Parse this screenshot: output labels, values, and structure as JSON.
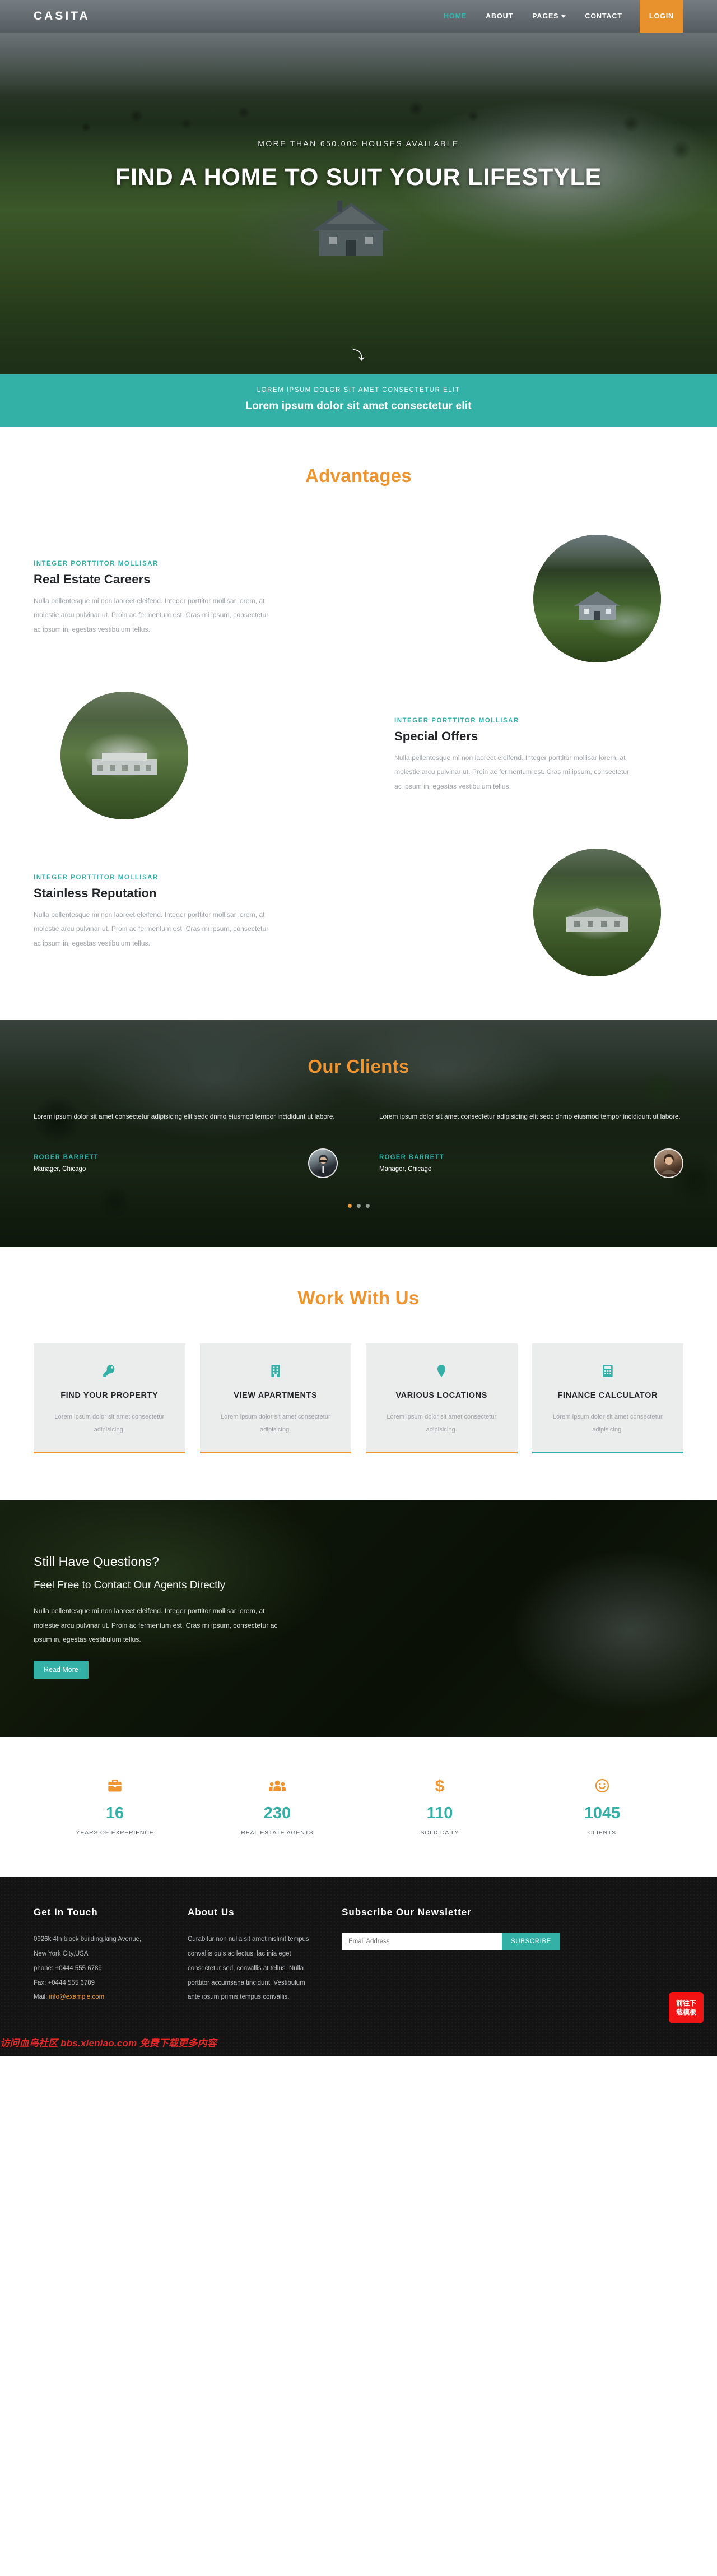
{
  "nav": {
    "brand": "CASITA",
    "items": [
      {
        "label": "HOME",
        "active": true,
        "caret": false
      },
      {
        "label": "ABOUT",
        "active": false,
        "caret": false
      },
      {
        "label": "PAGES",
        "active": false,
        "caret": true
      },
      {
        "label": "CONTACT",
        "active": false,
        "caret": false
      }
    ],
    "login_label": "LOGIN",
    "accent_teal": "#2eb8ae",
    "accent_orange": "#e8922e"
  },
  "hero": {
    "subtitle": "MORE THAN 650.000 HOUSES AVAILABLE",
    "title": "FIND A HOME TO SUIT YOUR LIFESTYLE",
    "scroll_icon": "chevron-down-icon"
  },
  "tealbar": {
    "small": "LOREM IPSUM DOLOR SIT AMET CONSECTETUR ELIT",
    "big": "Lorem ipsum dolor sit amet consectetur elit",
    "bg": "#33b1a7"
  },
  "advantages": {
    "title": "Advantages",
    "title_color": "#ee9531",
    "items": [
      {
        "kicker": "INTEGER PORTTITOR MOLLISAR",
        "heading": "Real Estate Careers",
        "body": "Nulla pellentesque mi non laoreet eleifend. Integer porttitor mollisar lorem, at molestie arcu pulvinar ut. Proin ac fermentum est. Cras mi ipsum, consectetur ac ipsum in, egestas vestibulum tellus.",
        "image_alt": "aerial-house-photo"
      },
      {
        "kicker": "INTEGER PORTTITOR MOLLISAR",
        "heading": "Special Offers",
        "body": "Nulla pellentesque mi non laoreet eleifend. Integer porttitor mollisar lorem, at molestie arcu pulvinar ut. Proin ac fermentum est. Cras mi ipsum, consectetur ac ipsum in, egestas vestibulum tellus.",
        "image_alt": "aerial-estate-photo"
      },
      {
        "kicker": "INTEGER PORTTITOR MOLLISAR",
        "heading": "Stainless Reputation",
        "body": "Nulla pellentesque mi non laoreet eleifend. Integer porttitor mollisar lorem, at molestie arcu pulvinar ut. Proin ac fermentum est. Cras mi ipsum, consectetur ac ipsum in, egestas vestibulum tellus.",
        "image_alt": "aerial-mansion-photo"
      }
    ]
  },
  "clients": {
    "title": "Our Clients",
    "testimonials": [
      {
        "quote": "Lorem ipsum dolor sit amet consectetur adipisicing elit sedc dnmo eiusmod tempor incididunt ut labore.",
        "name": "ROGER BARRETT",
        "role": "Manager, Chicago",
        "avatar": "avatar-man-glasses"
      },
      {
        "quote": "Lorem ipsum dolor sit amet consectetur adipisicing elit sedc dnmo eiusmod tempor incididunt ut labore.",
        "name": "ROGER BARRETT",
        "role": "Manager, Chicago",
        "avatar": "avatar-man-smiling"
      }
    ],
    "dots": [
      true,
      false,
      false
    ]
  },
  "work": {
    "title": "Work With Us",
    "cards": [
      {
        "icon": "key-icon",
        "heading": "FIND YOUR PROPERTY",
        "body": "Lorem ipsum dolor sit amet consectetur adipisicing.",
        "accent": "#ee9531"
      },
      {
        "icon": "building-icon",
        "heading": "VIEW APARTMENTS",
        "body": "Lorem ipsum dolor sit amet consectetur adipisicing.",
        "accent": "#ee9531"
      },
      {
        "icon": "map-pin-icon",
        "heading": "VARIOUS LOCATIONS",
        "body": "Lorem ipsum dolor sit amet consectetur adipisicing.",
        "accent": "#ee9531"
      },
      {
        "icon": "calculator-icon",
        "heading": "FINANCE CALCULATOR",
        "body": "Lorem ipsum dolor sit amet consectetur adipisicing.",
        "accent": "#33b1a7"
      }
    ]
  },
  "questions": {
    "heading": "Still Have Questions?",
    "subheading": "Feel Free to Contact Our Agents Directly",
    "body": "Nulla pellentesque mi non laoreet eleifend. Integer porttitor mollisar lorem, at molestie arcu pulvinar ut. Proin ac fermentum est. Cras mi ipsum, consectetur ac ipsum in, egestas vestibulum tellus.",
    "button_label": "Read More"
  },
  "counters": [
    {
      "icon": "briefcase-icon",
      "value": "16",
      "label": "YEARS OF EXPERIENCE"
    },
    {
      "icon": "people-group-icon",
      "value": "230",
      "label": "REAL ESTATE AGENTS"
    },
    {
      "icon": "dollar-sign-icon",
      "value": "110",
      "label": "SOLD DAILY"
    },
    {
      "icon": "smiley-face-icon",
      "value": "1045",
      "label": "CLIENTS"
    }
  ],
  "footer": {
    "contact": {
      "heading": "Get In Touch",
      "address_1": "0926k 4th block building,king Avenue,",
      "address_2": "New York City,USA",
      "phone": "phone: +0444 555 6789",
      "fax": "Fax: +0444 555 6789",
      "mail_label": "Mail:",
      "mail": "info@example.com"
    },
    "about": {
      "heading": "About Us",
      "body": "Curabitur non nulla sit amet nislinit tempus convallis quis ac lectus. lac inia eget consectetur sed, convallis at tellus. Nulla porttitor accumsana tincidunt. Vestibulum ante ipsum primis tempus convallis."
    },
    "newsletter": {
      "heading": "Subscribe Our Newsletter",
      "placeholder": "Email Address",
      "value": "",
      "button_label": "SUBSCRIBE"
    },
    "watermark": "访问血鸟社区 bbs.xieniao.com 免费下载更多内容",
    "download_button": "前往下载模板"
  }
}
